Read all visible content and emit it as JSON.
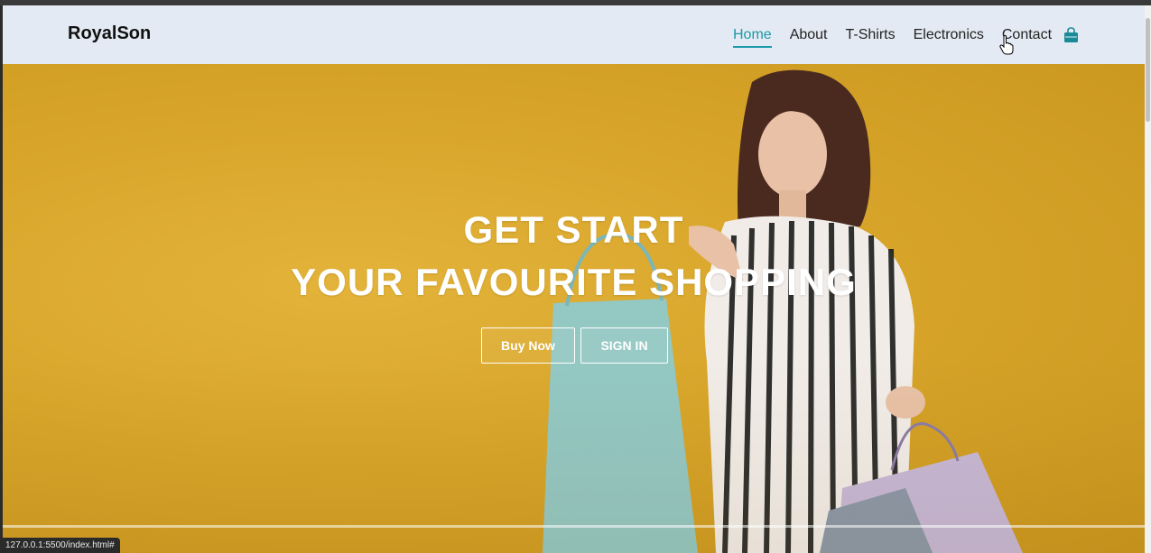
{
  "brand": {
    "name": "RoyalSon"
  },
  "nav": {
    "items": [
      {
        "label": "Home",
        "active": true
      },
      {
        "label": "About"
      },
      {
        "label": "T-Shirts"
      },
      {
        "label": "Electronics"
      },
      {
        "label": "Contact"
      }
    ],
    "cart_icon": "shopping-bag-icon"
  },
  "hero": {
    "line1": "GET START",
    "line2": "YOUR FAVOURITE SHOPPING",
    "buy_label": "Buy Now",
    "signin_label": "SIGN IN"
  },
  "status": {
    "url": "127.0.0.1:5500/index.html#"
  },
  "colors": {
    "accent": "#1a9aa8",
    "hero_bg": "#d8a52a",
    "nav_bg": "#e4eaf3"
  }
}
